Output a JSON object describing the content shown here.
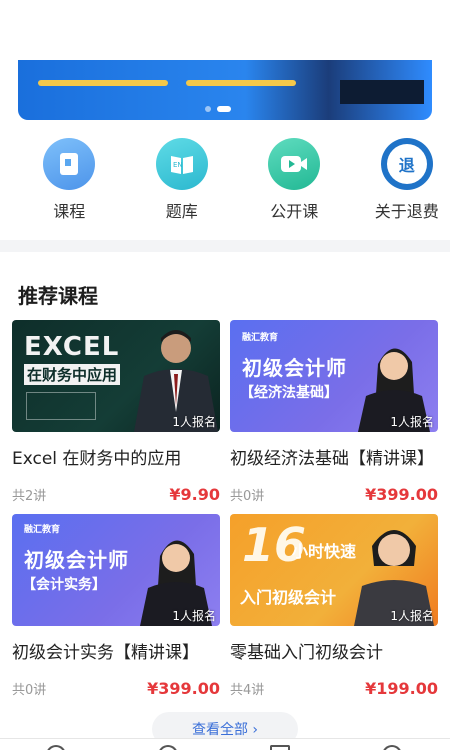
{
  "banner": {
    "active_slide": 2,
    "slide_count": 2
  },
  "quick_nav": [
    {
      "label": "课程",
      "icon": "book-icon",
      "color": "#5aa7f0"
    },
    {
      "label": "题库",
      "icon": "question-bank-icon",
      "color": "#3cc6d8"
    },
    {
      "label": "公开课",
      "icon": "video-icon",
      "color": "#34c7a6"
    },
    {
      "label": "关于退费",
      "icon": "refund-icon",
      "color": "#1f73c8",
      "icon_text": "退"
    }
  ],
  "section": {
    "title": "推荐课程"
  },
  "courses": [
    {
      "title": "Excel 在财务中的应用",
      "lessons": "共2讲",
      "price": "¥9.90",
      "enrolled": "1人报名",
      "thumb_main": "EXCEL",
      "thumb_sub": "在财务中应用"
    },
    {
      "title": "初级经济法基础【精讲课】",
      "lessons": "共0讲",
      "price": "¥399.00",
      "enrolled": "1人报名",
      "thumb_brand": "融汇教育",
      "thumb_main": "初级会计师",
      "thumb_sub": "【经济法基础】"
    },
    {
      "title": "初级会计实务【精讲课】",
      "lessons": "共0讲",
      "price": "¥399.00",
      "enrolled": "1人报名",
      "thumb_brand": "融汇教育",
      "thumb_main": "初级会计师",
      "thumb_sub": "【会计实务】"
    },
    {
      "title": "零基础入门初级会计",
      "lessons": "共4讲",
      "price": "¥199.00",
      "enrolled": "1人报名",
      "thumb_main": "16",
      "thumb_sub": "小时快速",
      "thumb_sub2": "入门初级会计"
    }
  ],
  "view_all": {
    "label": "查看全部 ›"
  },
  "tabbar": {
    "icons": [
      "home-icon",
      "calendar-icon",
      "document-icon",
      "user-icon"
    ]
  }
}
